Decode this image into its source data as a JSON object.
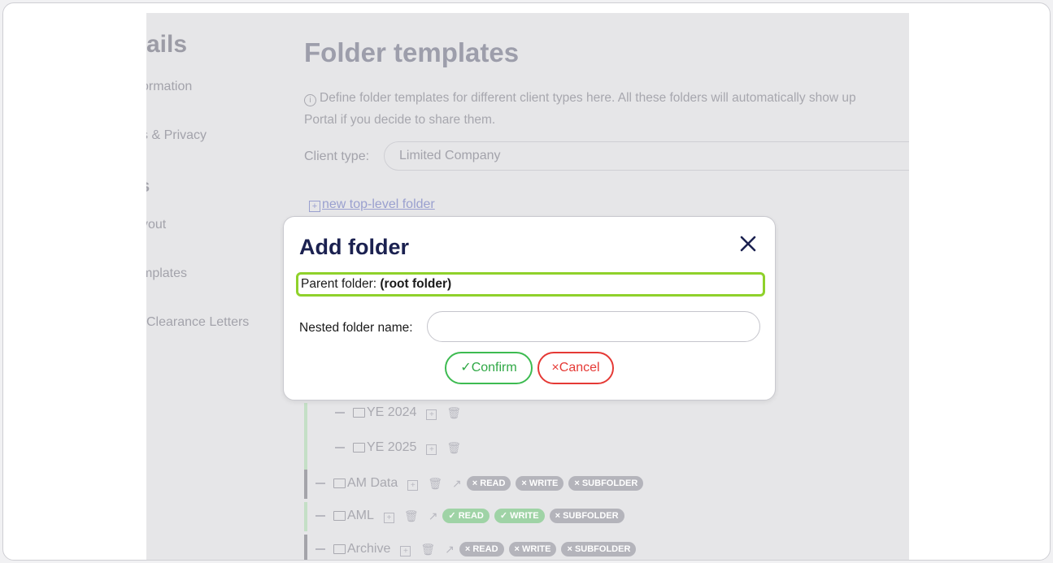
{
  "sidebar": {
    "title": "tails",
    "items": [
      "ormation",
      "s & Privacy",
      "yout",
      "mplates",
      "Clearance Letters"
    ],
    "section": "s"
  },
  "main": {
    "title": "Folder templates",
    "description_line1": "Define folder templates for different client types here. All these folders will automatically show up",
    "description_line2": "Portal if you decide to share them.",
    "client_type_label": "Client type:",
    "client_type_value": "Limited Company",
    "new_top_level": "new top-level folder"
  },
  "tree": {
    "subfolders": [
      {
        "name": "YE 2024"
      },
      {
        "name": "YE 2025"
      }
    ],
    "folders": [
      {
        "name": "AM Data",
        "read": "READ",
        "write": "WRITE",
        "subfolder": "SUBFOLDER",
        "read_on": false,
        "write_on": false
      },
      {
        "name": "AML",
        "read": "READ",
        "write": "WRITE",
        "subfolder": "SUBFOLDER",
        "read_on": true,
        "write_on": true
      },
      {
        "name": "Archive",
        "read": "READ",
        "write": "WRITE",
        "subfolder": "SUBFOLDER",
        "read_on": false,
        "write_on": false
      }
    ]
  },
  "modal": {
    "title": "Add folder",
    "parent_label": "Parent folder:",
    "parent_value": "(root folder)",
    "name_label": "Nested folder name:",
    "name_value": "",
    "confirm": "Confirm",
    "cancel": "Cancel",
    "colors": {
      "highlight": "#8fd12b",
      "confirm": "#3dbb51",
      "cancel": "#e53935",
      "title": "#1b2150"
    }
  }
}
